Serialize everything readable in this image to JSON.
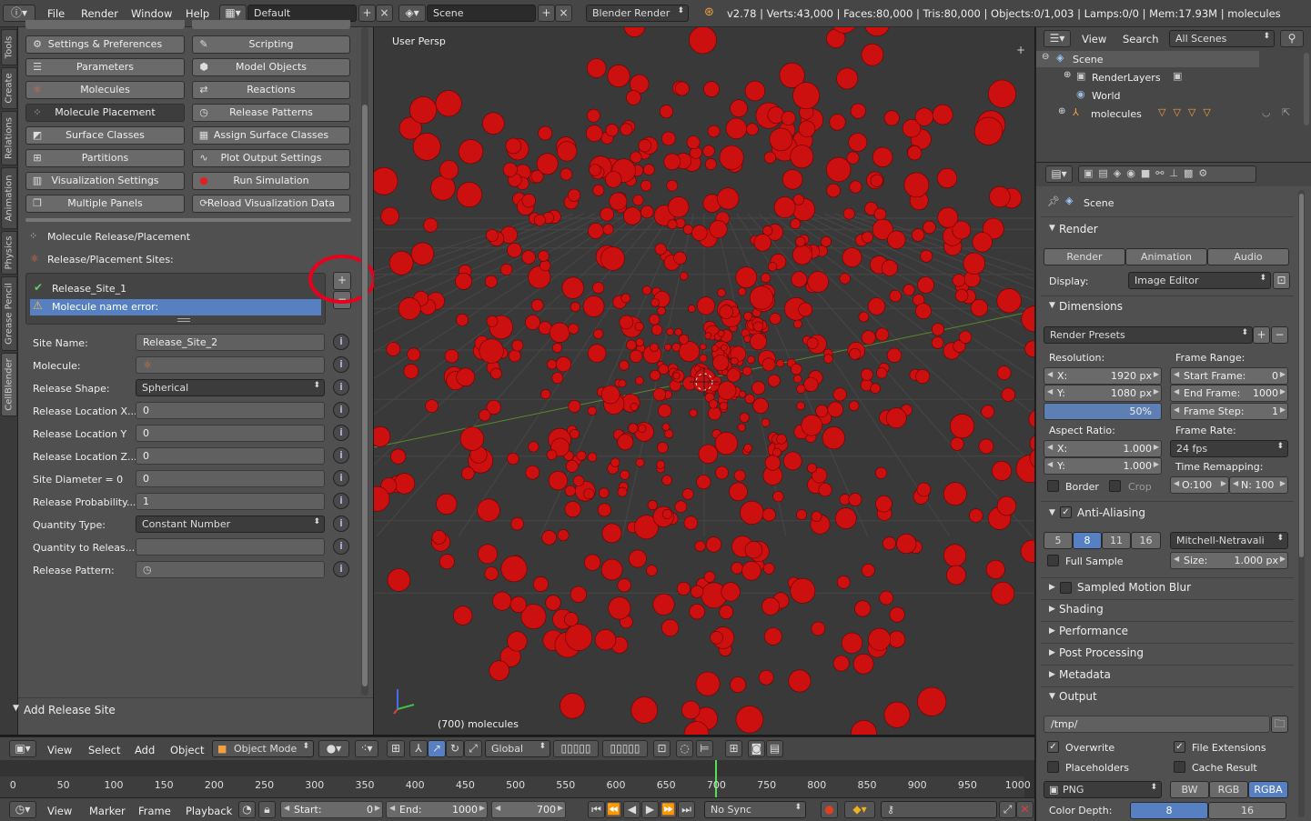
{
  "topbar": {
    "menus": [
      "File",
      "Render",
      "Window",
      "Help"
    ],
    "layout": "Default",
    "scene": "Scene",
    "engine": "Blender Render",
    "stats": "v2.78 | Verts:43,000 | Faces:80,000 | Tris:80,000 | Objects:0/1,003 | Lamps:0/0 | Mem:17.93M | molecules"
  },
  "tool_tabs": [
    "Tools",
    "Create",
    "Relations",
    "Animation",
    "Physics",
    "Grease Pencil",
    "CellBlender"
  ],
  "panel_buttons": [
    {
      "label": "Settings & Preferences",
      "icon": "preferences-icon"
    },
    {
      "label": "Scripting",
      "icon": "scripting-icon"
    },
    {
      "label": "Parameters",
      "icon": "parameters-icon"
    },
    {
      "label": "Model Objects",
      "icon": "model-objects-icon"
    },
    {
      "label": "Molecules",
      "icon": "molecules-icon"
    },
    {
      "label": "Reactions",
      "icon": "reactions-icon"
    },
    {
      "label": "Molecule Placement",
      "icon": "placement-icon"
    },
    {
      "label": "Release Patterns",
      "icon": "release-patterns-icon"
    },
    {
      "label": "Surface Classes",
      "icon": "surface-classes-icon"
    },
    {
      "label": "Assign Surface Classes",
      "icon": "assign-surface-icon"
    },
    {
      "label": "Partitions",
      "icon": "partitions-icon"
    },
    {
      "label": "Plot Output Settings",
      "icon": "plot-icon"
    },
    {
      "label": "Visualization Settings",
      "icon": "visualization-icon"
    },
    {
      "label": "Run Simulation",
      "icon": "run-icon"
    },
    {
      "label": "Multiple Panels",
      "icon": "multiple-panels-icon"
    },
    {
      "label": "Reload Visualization Data",
      "icon": "reload-icon"
    }
  ],
  "placement": {
    "section_title": "Molecule Release/Placement",
    "sites_label": "Release/Placement Sites:",
    "sites": [
      "Release_Site_1",
      "Molecule name error:"
    ],
    "fields": [
      {
        "label": "Site Name:",
        "value": "Release_Site_2",
        "kind": "text"
      },
      {
        "label": "Molecule:",
        "value": "",
        "kind": "search"
      },
      {
        "label": "Release Shape:",
        "value": "Spherical",
        "kind": "dropdown"
      },
      {
        "label": "Release Location X...",
        "value": "0",
        "kind": "text"
      },
      {
        "label": "Release Location Y",
        "value": "0",
        "kind": "text"
      },
      {
        "label": "Release Location Z...",
        "value": "0",
        "kind": "text"
      },
      {
        "label": "Site Diameter = 0",
        "value": "0",
        "kind": "text"
      },
      {
        "label": "Release Probability...",
        "value": "1",
        "kind": "text"
      },
      {
        "label": "Quantity Type:",
        "value": "Constant Number",
        "kind": "dropdown"
      },
      {
        "label": "Quantity to Releas...",
        "value": "",
        "kind": "text"
      },
      {
        "label": "Release Pattern:",
        "value": "",
        "kind": "search"
      }
    ],
    "add_release_site": "Add Release Site"
  },
  "viewport": {
    "view_label": "User Persp",
    "object_label": "(700) molecules"
  },
  "outliner": {
    "header": [
      "View",
      "Search",
      "All Scenes"
    ],
    "items": [
      {
        "label": "Scene"
      },
      {
        "label": "RenderLayers"
      },
      {
        "label": "World"
      },
      {
        "label": "molecules"
      }
    ]
  },
  "props": {
    "context": "Scene",
    "render_section": "Render",
    "render_buttons": [
      "Render",
      "Animation",
      "Audio"
    ],
    "display_label": "Display:",
    "display_value": "Image Editor",
    "dimensions_section": "Dimensions",
    "render_presets": "Render Presets",
    "resolution_label": "Resolution:",
    "res_x": {
      "label": "X:",
      "value": "1920 px"
    },
    "res_y": {
      "label": "Y:",
      "value": "1080 px"
    },
    "res_pct": "50%",
    "aspect_label": "Aspect Ratio:",
    "asp_x": {
      "label": "X:",
      "value": "1.000"
    },
    "asp_y": {
      "label": "Y:",
      "value": "1.000"
    },
    "border": "Border",
    "crop": "Crop",
    "frame_range_label": "Frame Range:",
    "start_frame": {
      "label": "Start Frame:",
      "value": "0"
    },
    "end_frame": {
      "label": "End Frame:",
      "value": "1000"
    },
    "frame_step": {
      "label": "Frame Step:",
      "value": "1"
    },
    "frame_rate_label": "Frame Rate:",
    "frame_rate": "24 fps",
    "time_remap_label": "Time Remapping:",
    "remap_old": "O:100",
    "remap_new": "N: 100",
    "aa_section": "Anti-Aliasing",
    "aa_samples": [
      "5",
      "8",
      "11",
      "16"
    ],
    "aa_filter": "Mitchell-Netravali",
    "full_sample": "Full Sample",
    "aa_size": {
      "label": "Size:",
      "value": "1.000 px"
    },
    "collapsed": [
      "Sampled Motion Blur",
      "Shading",
      "Performance",
      "Post Processing",
      "Metadata"
    ],
    "output_section": "Output",
    "output_path": "/tmp/",
    "overwrite": "Overwrite",
    "file_extensions": "File Extensions",
    "placeholders": "Placeholders",
    "cache_result": "Cache Result",
    "format": "PNG",
    "color_modes": [
      "BW",
      "RGB",
      "RGBA"
    ],
    "color_depth_label": "Color Depth:",
    "color_depths": [
      "8",
      "16"
    ]
  },
  "viewport_header": {
    "menus": [
      "View",
      "Select",
      "Add",
      "Object"
    ],
    "mode": "Object Mode",
    "orientation": "Global"
  },
  "timeline": {
    "ticks": [
      "0",
      "50",
      "100",
      "150",
      "200",
      "250",
      "300",
      "350",
      "400",
      "450",
      "500",
      "550",
      "600",
      "650",
      "700",
      "750",
      "800",
      "850",
      "900",
      "950",
      "1000"
    ],
    "current_frame_value": 700,
    "menus": [
      "View",
      "Marker",
      "Frame",
      "Playback"
    ],
    "start": {
      "label": "Start:",
      "value": "0"
    },
    "end": {
      "label": "End:",
      "value": "1000"
    },
    "current": "700",
    "sync": "No Sync"
  },
  "colors": {
    "molecule": "#cc1010",
    "selection": "#5680c2",
    "highlight_circle": "#e8001c"
  }
}
